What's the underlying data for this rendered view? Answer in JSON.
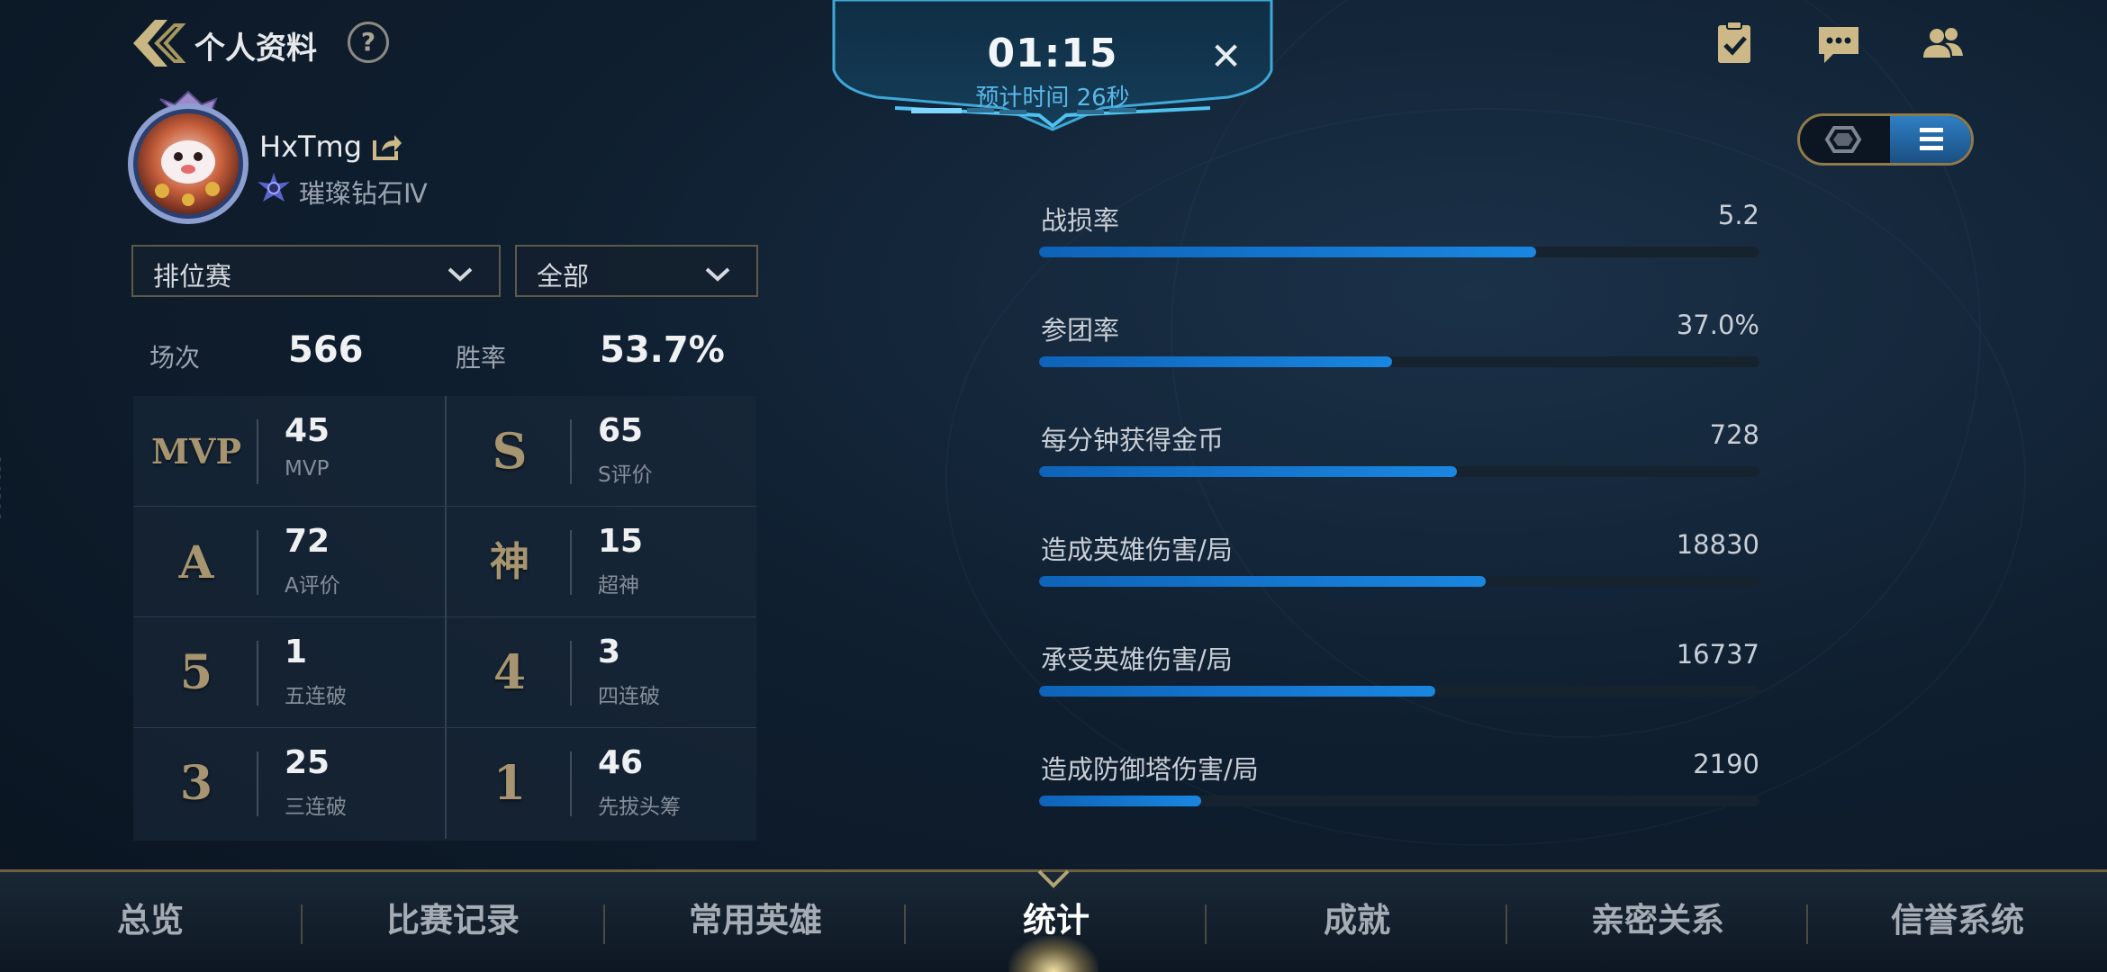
{
  "header": {
    "title": "个人资料",
    "help_label": "?"
  },
  "timer": {
    "time": "01:15",
    "estimate": "预计时间 26秒",
    "close_label": "✕"
  },
  "profile": {
    "name": "HxTmg",
    "rank": "璀璨钻石Ⅳ"
  },
  "filters": {
    "mode": "排位赛",
    "scope": "全部"
  },
  "summary": {
    "matches_label": "场次",
    "matches_value": "566",
    "winrate_label": "胜率",
    "winrate_value": "53.7%"
  },
  "stats": [
    {
      "badge": "MVP",
      "value": "45",
      "label": "MVP"
    },
    {
      "badge": "S",
      "value": "65",
      "label": "S评价"
    },
    {
      "badge": "A",
      "value": "72",
      "label": "A评价"
    },
    {
      "badge": "神",
      "value": "15",
      "label": "超神"
    },
    {
      "badge": "5",
      "value": "1",
      "label": "五连破"
    },
    {
      "badge": "4",
      "value": "3",
      "label": "四连破"
    },
    {
      "badge": "3",
      "value": "25",
      "label": "三连破"
    },
    {
      "badge": "1",
      "value": "46",
      "label": "先拔头筹"
    }
  ],
  "bars": [
    {
      "label": "战损率",
      "value": "5.2",
      "fill": 0.69
    },
    {
      "label": "参团率",
      "value": "37.0%",
      "fill": 0.49
    },
    {
      "label": "每分钟获得金币",
      "value": "728",
      "fill": 0.58
    },
    {
      "label": "造成英雄伤害/局",
      "value": "18830",
      "fill": 0.62
    },
    {
      "label": "承受英雄伤害/局",
      "value": "16737",
      "fill": 0.55
    },
    {
      "label": "造成防御塔伤害/局",
      "value": "2190",
      "fill": 0.225
    }
  ],
  "nav": {
    "items": [
      "总览",
      "比赛记录",
      "常用英雄",
      "统计",
      "成就",
      "亲密关系",
      "信誉系统"
    ],
    "active_index": 3
  },
  "side_id": "6614306",
  "icons": {
    "back": "back-arrow-icon",
    "help": "help-icon",
    "tasks": "clipboard-check-icon",
    "chat": "chat-icon",
    "friends": "friends-icon",
    "share": "share-icon",
    "rank": "diamond-rank-icon",
    "hexagon_view": "hexagon-icon",
    "list_view": "list-icon",
    "dropdown": "chevron-down-icon"
  },
  "colors": {
    "bar_fill": "#1a86e0",
    "gold_accent": "#a69570",
    "timer_accent": "#5bb8ea"
  }
}
